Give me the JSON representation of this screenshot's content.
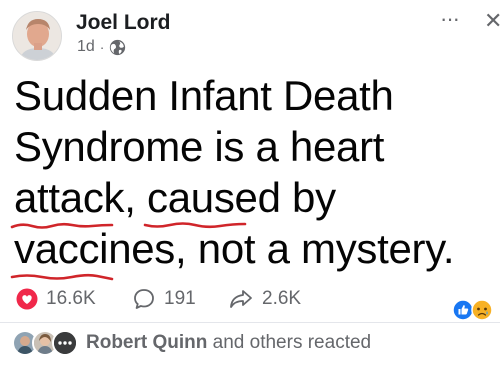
{
  "author": {
    "name": "Joel Lord",
    "time": "1d",
    "separator": "·",
    "audience_icon": "globe-icon"
  },
  "menu": {
    "more_icon": "more-horizontal-icon",
    "more_glyph": "···",
    "close_icon": "close-icon",
    "close_glyph": "✕"
  },
  "post": {
    "lines": [
      [
        "Sudden Infant Death"
      ],
      [
        "Syndrome is a heart"
      ],
      [
        "attack",
        ", ",
        "caused by"
      ],
      [
        "vaccines",
        ", ",
        "not a mystery."
      ]
    ],
    "underline_color": "#d0252a"
  },
  "stats": {
    "likes": "16.6K",
    "comments": "191",
    "shares": "2.6K",
    "like_icon": "heart-icon",
    "comment_icon": "comment-icon",
    "share_icon": "share-icon",
    "reaction_icons": [
      "like-reaction-icon",
      "sad-reaction-icon"
    ]
  },
  "reacted": {
    "name": "Robert Quinn",
    "rest": " and others reacted"
  },
  "colors": {
    "heart": "#f0284a",
    "like_blue": "#1877f2",
    "sad_yellow": "#f7b125",
    "meta_gray": "#65676b"
  }
}
